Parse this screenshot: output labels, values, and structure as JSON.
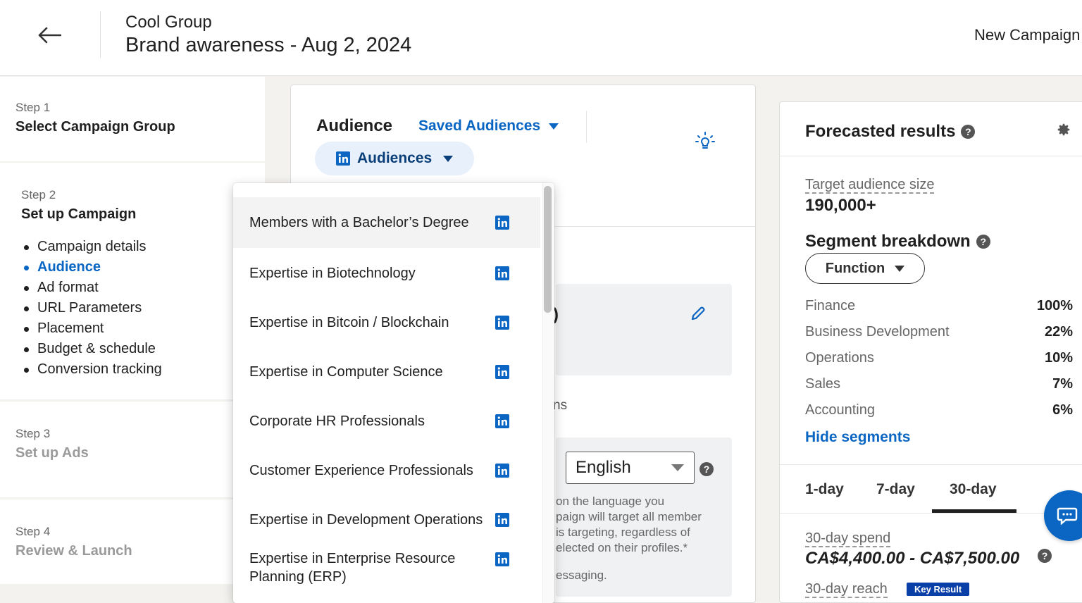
{
  "header": {
    "group_name": "Cool Group",
    "campaign_name": "Brand awareness - Aug 2, 2024",
    "new_campaign_label": "New Campaign"
  },
  "steps": [
    {
      "small": "Step 1",
      "title": "Select Campaign Group"
    },
    {
      "small": "Step 2",
      "title": "Set up Campaign",
      "substeps": [
        "Campaign details",
        "Audience",
        "Ad format",
        "URL Parameters",
        "Placement",
        "Budget & schedule",
        "Conversion tracking"
      ],
      "active_substep": "Audience"
    },
    {
      "small": "Step 3",
      "title": "Set up Ads"
    },
    {
      "small": "Step 4",
      "title": "Review & Launch"
    }
  ],
  "audience": {
    "label": "Audience",
    "saved_audiences_label": "Saved Audiences",
    "pill_label": "Audiences",
    "partial_paren": ")",
    "partial_ns": "ns",
    "language": {
      "selected": "English",
      "note": "on the language you\npaign will target all member\n is targeting, regardless of\nelected on their profiles.*",
      "note2": "essaging."
    }
  },
  "dropdown": {
    "items": [
      "Members with a Bachelor’s Degree",
      "Expertise in Biotechnology",
      "Expertise in Bitcoin / Blockchain",
      "Expertise in Computer Science",
      "Corporate HR Professionals",
      "Customer Experience Professionals",
      "Expertise in Development Operations",
      "Expertise in Enterprise Resource Planning (ERP)"
    ],
    "hovered_index": 0
  },
  "forecast": {
    "title": "Forecasted results",
    "target_audience_label": "Target audience size",
    "target_audience_value": "190,000+",
    "segment_title": "Segment breakdown",
    "segment_filter": "Function",
    "segments": [
      {
        "name": "Finance",
        "pct": "100%"
      },
      {
        "name": "Business Development",
        "pct": "22%"
      },
      {
        "name": "Operations",
        "pct": "10%"
      },
      {
        "name": "Sales",
        "pct": "7%"
      },
      {
        "name": "Accounting",
        "pct": "6%"
      }
    ],
    "hide_segments_label": "Hide segments",
    "tabs": [
      "1-day",
      "7-day",
      "30-day"
    ],
    "active_tab": "30-day",
    "spend_label": "30-day spend",
    "spend_value": "CA$4,400.00 - CA$7,500.00",
    "reach_label": "30-day reach",
    "key_result_badge": "Key Result"
  },
  "colors": {
    "accent": "#0a66c2",
    "linkedin": "#0a66c2",
    "badge": "#0a3fa8",
    "pill_bg": "#e8f0fb"
  },
  "icons": {
    "back": "arrow-left-icon",
    "bulb": "lightbulb-icon",
    "edit": "pencil-icon",
    "help": "question-circle-icon",
    "settings": "gear-icon",
    "linkedin": "linkedin-icon",
    "chat": "chat-icon"
  }
}
